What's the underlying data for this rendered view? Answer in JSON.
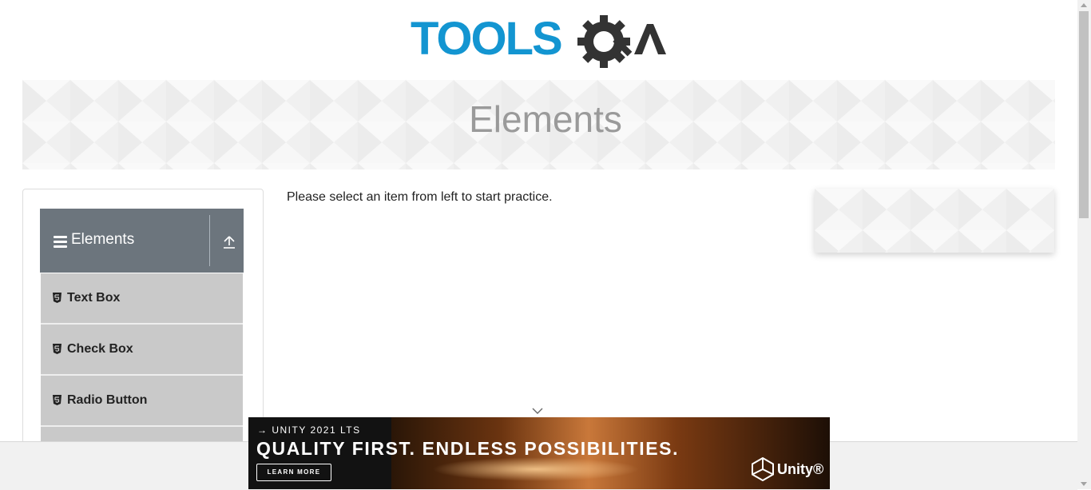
{
  "logo": {
    "text_left": "TOOLS",
    "text_right": "QA",
    "colors": {
      "blue": "#1395d1",
      "dark": "#333333"
    }
  },
  "banner": {
    "title": "Elements"
  },
  "sidebar": {
    "group_title": "Elements",
    "header_color": "#6c757d",
    "items": [
      {
        "label": "Text Box",
        "icon": "html5-icon"
      },
      {
        "label": "Check Box",
        "icon": "html5-icon"
      },
      {
        "label": "Radio Button",
        "icon": "html5-icon"
      }
    ]
  },
  "main": {
    "prompt": "Please select an item from left to start practice."
  },
  "ad": {
    "tag": "→ UNITY 2021 LTS",
    "headline": "QUALITY FIRST. ENDLESS POSSIBILITIES.",
    "cta": "LEARN MORE",
    "brand": "Unity®"
  }
}
